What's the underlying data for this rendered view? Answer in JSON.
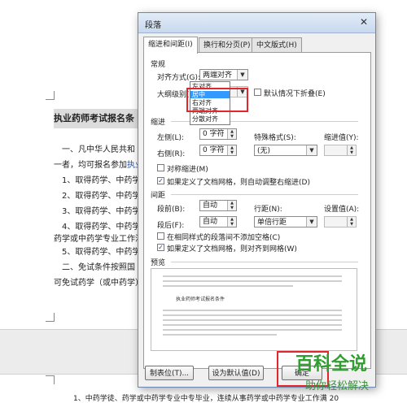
{
  "document": {
    "title": "执业药师考试报名条",
    "lines": [
      "一、凡中华人民共和",
      "一者，均可报名参加",
      "1、取得药学、中药学",
      "2、取得药学、中药学",
      "3、取得药学、中药学",
      "4、取得药学、中药学",
      "药学或中药学专业工作满",
      "5、取得药学、中药学",
      "二、免试条件按照国",
      "可免试药学（或中药学）"
    ],
    "link_text": "执业药",
    "bottom_line": "1、中药学徒、药学或中药学专业中专毕业，连续从事药学或中药学专业工作满 20"
  },
  "dialog": {
    "title": "段落",
    "close_glyph": "✕",
    "tabs": [
      "缩进和间距(I)",
      "换行和分页(P)",
      "中文版式(H)"
    ],
    "general": {
      "section": "常规",
      "alignment_label": "对齐方式(G):",
      "alignment_value": "两端对齐",
      "outline_label": "大纲级别(O):",
      "collapse_label": "默认情况下折叠(E)",
      "alignment_options": [
        "左对齐",
        "居中",
        "右对齐",
        "两端对齐",
        "分散对齐"
      ],
      "selected_option": "居中"
    },
    "indent": {
      "section": "缩进",
      "left_label": "左侧(L):",
      "left_value": "0 字符",
      "right_label": "右侧(R):",
      "right_value": "0 字符",
      "special_label": "特殊格式(S):",
      "special_value": "(无)",
      "indent_value_label": "缩进值(Y):",
      "mirror_label": "对称缩进(M)",
      "auto_adjust_label": "如果定义了文档网格，则自动调整右缩进(D)"
    },
    "spacing": {
      "section": "间距",
      "before_label": "段前(B):",
      "before_value": "自动",
      "after_label": "段后(F):",
      "after_value": "自动",
      "line_label": "行距(N):",
      "line_value": "单倍行距",
      "setting_label": "设置值(A):",
      "no_space_label": "在相同样式的段落间不添加空格(C)",
      "snap_grid_label": "如果定义了文档网格，则对齐到网格(W)"
    },
    "preview": {
      "section": "预览",
      "sample_text": "执业药师考试报名条件"
    },
    "buttons": {
      "tabs": "制表位(T)...",
      "default": "设为默认值(D)",
      "ok": "确定"
    },
    "checkmark": "✓"
  },
  "watermark": {
    "logo": "百科全说",
    "sub": "助你轻松解决"
  },
  "colors": {
    "highlight": "#e3262b",
    "selection": "#3399ff",
    "watermark": "#2f9e2f"
  }
}
